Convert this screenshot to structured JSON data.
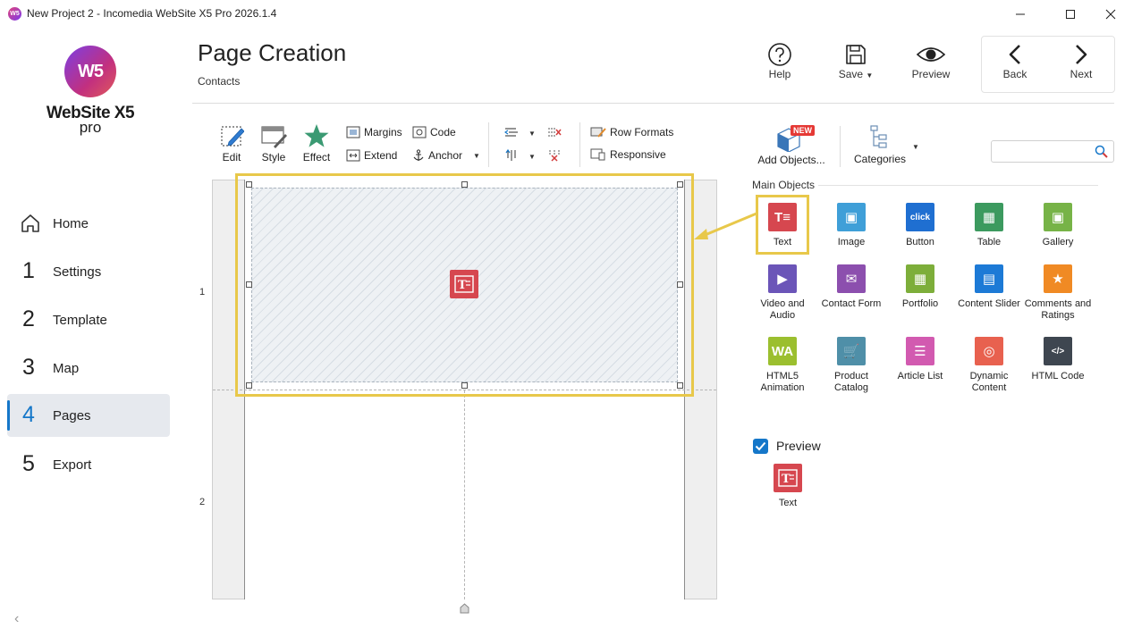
{
  "window": {
    "title": "New Project 2 - Incomedia WebSite X5 Pro 2026.1.4"
  },
  "logo": {
    "mark": "W5",
    "name": "WebSite X5",
    "edition": "pro"
  },
  "sidebar": {
    "items": [
      {
        "num": "",
        "label": "Home"
      },
      {
        "num": "1",
        "label": "Settings"
      },
      {
        "num": "2",
        "label": "Template"
      },
      {
        "num": "3",
        "label": "Map"
      },
      {
        "num": "4",
        "label": "Pages",
        "active": true
      },
      {
        "num": "5",
        "label": "Export"
      }
    ],
    "collapse_glyph": "‹"
  },
  "header": {
    "title": "Page Creation",
    "subtitle": "Contacts",
    "buttons": {
      "help": "Help",
      "save": "Save",
      "preview": "Preview",
      "back": "Back",
      "next": "Next"
    }
  },
  "toolbar": {
    "edit": "Edit",
    "style": "Style",
    "effect": "Effect",
    "margins": "Margins",
    "extend": "Extend",
    "code": "Code",
    "anchor": "Anchor",
    "row_formats": "Row Formats",
    "responsive": "Responsive",
    "add_objects": "Add Objects...",
    "new_badge": "NEW",
    "categories": "Categories"
  },
  "canvas": {
    "rows": [
      "1",
      "2"
    ]
  },
  "objects_panel": {
    "section_title": "Main Objects",
    "items": [
      {
        "label": "Text",
        "color": "#d6474f",
        "glyph": "T≡"
      },
      {
        "label": "Image",
        "color": "#3f9fd8",
        "glyph": "▣"
      },
      {
        "label": "Button",
        "color": "#1f6fd1",
        "glyph": "click"
      },
      {
        "label": "Table",
        "color": "#3c9a5f",
        "glyph": "▦"
      },
      {
        "label": "Gallery",
        "color": "#77b347",
        "glyph": "▣"
      },
      {
        "label": "Video and Audio",
        "color": "#6b55b8",
        "glyph": "▶"
      },
      {
        "label": "Contact Form",
        "color": "#8c4fae",
        "glyph": "✉"
      },
      {
        "label": "Portfolio",
        "color": "#7dae3a",
        "glyph": "▦"
      },
      {
        "label": "Content Slider",
        "color": "#1d7ad6",
        "glyph": "▤"
      },
      {
        "label": "Comments and Ratings",
        "color": "#f08a24",
        "glyph": "★"
      },
      {
        "label": "HTML5 Animation",
        "color": "#9bbf2f",
        "glyph": "WA"
      },
      {
        "label": "Product Catalog",
        "color": "#4f8fa8",
        "glyph": "🛒"
      },
      {
        "label": "Article List",
        "color": "#d25ab0",
        "glyph": "☰"
      },
      {
        "label": "Dynamic Content",
        "color": "#e8614f",
        "glyph": "◎"
      },
      {
        "label": "HTML Code",
        "color": "#3e4650",
        "glyph": "</>"
      }
    ]
  },
  "preview": {
    "label": "Preview",
    "checked": true,
    "item_label": "Text"
  }
}
